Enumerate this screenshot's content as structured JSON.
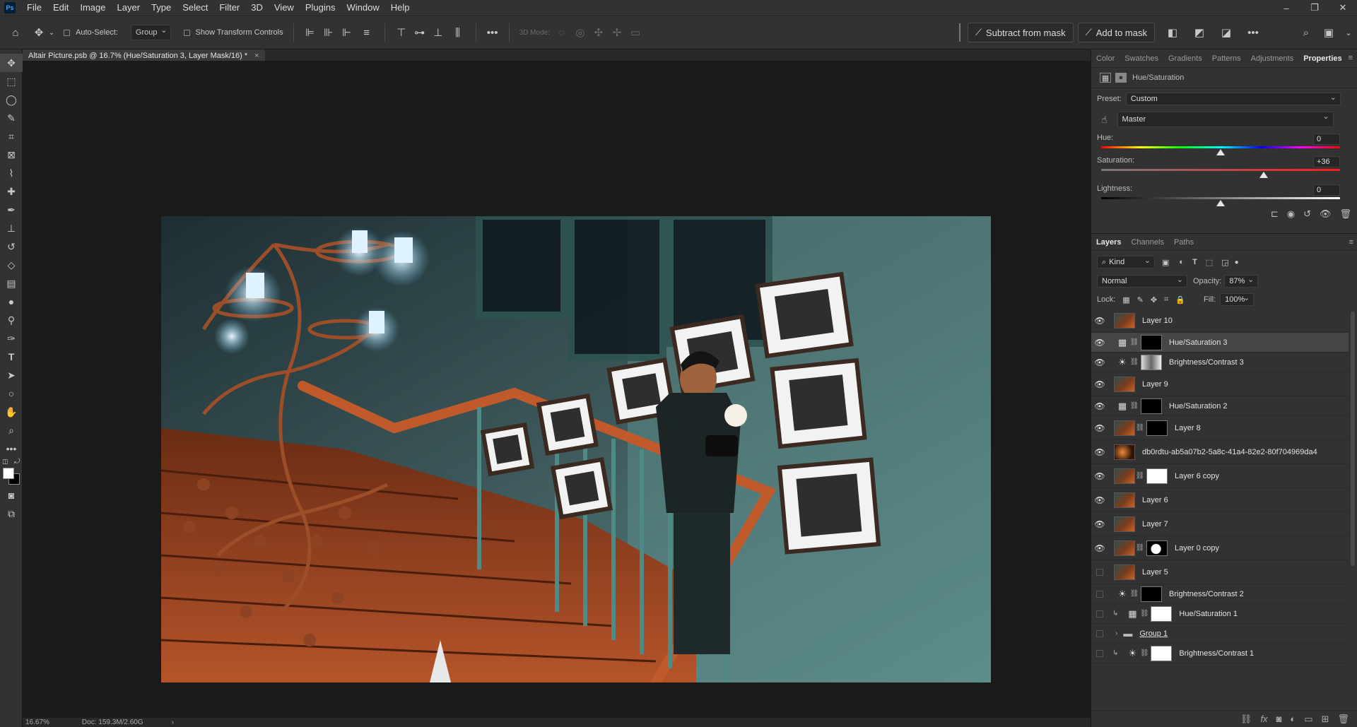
{
  "menubar": {
    "logo": "Ps",
    "items": [
      "File",
      "Edit",
      "Image",
      "Layer",
      "Type",
      "Select",
      "Filter",
      "3D",
      "View",
      "Plugins",
      "Window",
      "Help"
    ]
  },
  "options": {
    "auto_select_label": "Auto-Select:",
    "auto_select_value": "Group",
    "transform_label": "Show Transform Controls",
    "mode_3d_label": "3D Mode:",
    "more": "•••",
    "subtract_mask": "Subtract from mask",
    "add_mask": "Add to mask"
  },
  "document": {
    "tab_title": "Altair Picture.psb @ 16.7% (Hue/Saturation 3, Layer Mask/16) *",
    "close": "×"
  },
  "status": {
    "zoom": "16.67%",
    "doc": "Doc: 159.3M/2.60G",
    "arrow": "›"
  },
  "properties": {
    "tabs": [
      "Color",
      "Swatches",
      "Gradients",
      "Patterns",
      "Adjustments",
      "Properties"
    ],
    "active_tab": "Properties",
    "title": "Hue/Saturation",
    "preset_label": "Preset:",
    "preset_value": "Custom",
    "channel_value": "Master",
    "hue_label": "Hue:",
    "hue_value": "0",
    "hue_position": 0.5,
    "saturation_label": "Saturation:",
    "saturation_value": "+36",
    "saturation_position": 0.68,
    "lightness_label": "Lightness:",
    "lightness_value": "0",
    "lightness_position": 0.5
  },
  "layers_panel": {
    "tabs": [
      "Layers",
      "Channels",
      "Paths"
    ],
    "active_tab": "Layers",
    "kind_label": "Kind",
    "blend_mode": "Normal",
    "opacity_label": "Opacity:",
    "opacity_value": "87%",
    "lock_label": "Lock:",
    "fill_label": "Fill:",
    "fill_value": "100%",
    "layers": [
      {
        "name": "Layer 10",
        "type": "pixel",
        "visible": true
      },
      {
        "name": "Hue/Saturation 3",
        "type": "huesat",
        "visible": true,
        "mask": "black",
        "selected": true
      },
      {
        "name": "Brightness/Contrast 3",
        "type": "brightness",
        "visible": true,
        "mask": "image"
      },
      {
        "name": "Layer 9",
        "type": "pixel",
        "visible": true
      },
      {
        "name": "Hue/Saturation 2",
        "type": "huesat",
        "visible": true,
        "mask": "black"
      },
      {
        "name": "Layer 8",
        "type": "pixel",
        "visible": true,
        "mask": "black"
      },
      {
        "name": "db0rdtu-ab5a07b2-5a8c-41a4-82e2-80f704969da4",
        "type": "smart",
        "visible": true
      },
      {
        "name": "Layer 6 copy",
        "type": "pixel",
        "visible": true,
        "mask": "white"
      },
      {
        "name": "Layer 6",
        "type": "pixel",
        "visible": true
      },
      {
        "name": "Layer 7",
        "type": "pixel",
        "visible": true
      },
      {
        "name": "Layer 0 copy",
        "type": "pixel",
        "visible": true,
        "mask": "shape"
      },
      {
        "name": "Layer 5",
        "type": "pixel",
        "visible": false
      },
      {
        "name": "Brightness/Contrast 2",
        "type": "brightness",
        "visible": false,
        "mask": "black"
      },
      {
        "name": "Hue/Saturation 1",
        "type": "huesat",
        "visible": false,
        "mask": "white",
        "clipped": true
      },
      {
        "name": "Group 1",
        "type": "group",
        "visible": false
      },
      {
        "name": "Brightness/Contrast 1",
        "type": "brightness",
        "visible": false,
        "mask": "white",
        "clipped": true
      }
    ]
  },
  "colors": {
    "panel_bg": "#323232",
    "app_bg": "#1e1e1e",
    "canvas_bg": "#1a1a1a",
    "accent": "#31a8ff"
  }
}
